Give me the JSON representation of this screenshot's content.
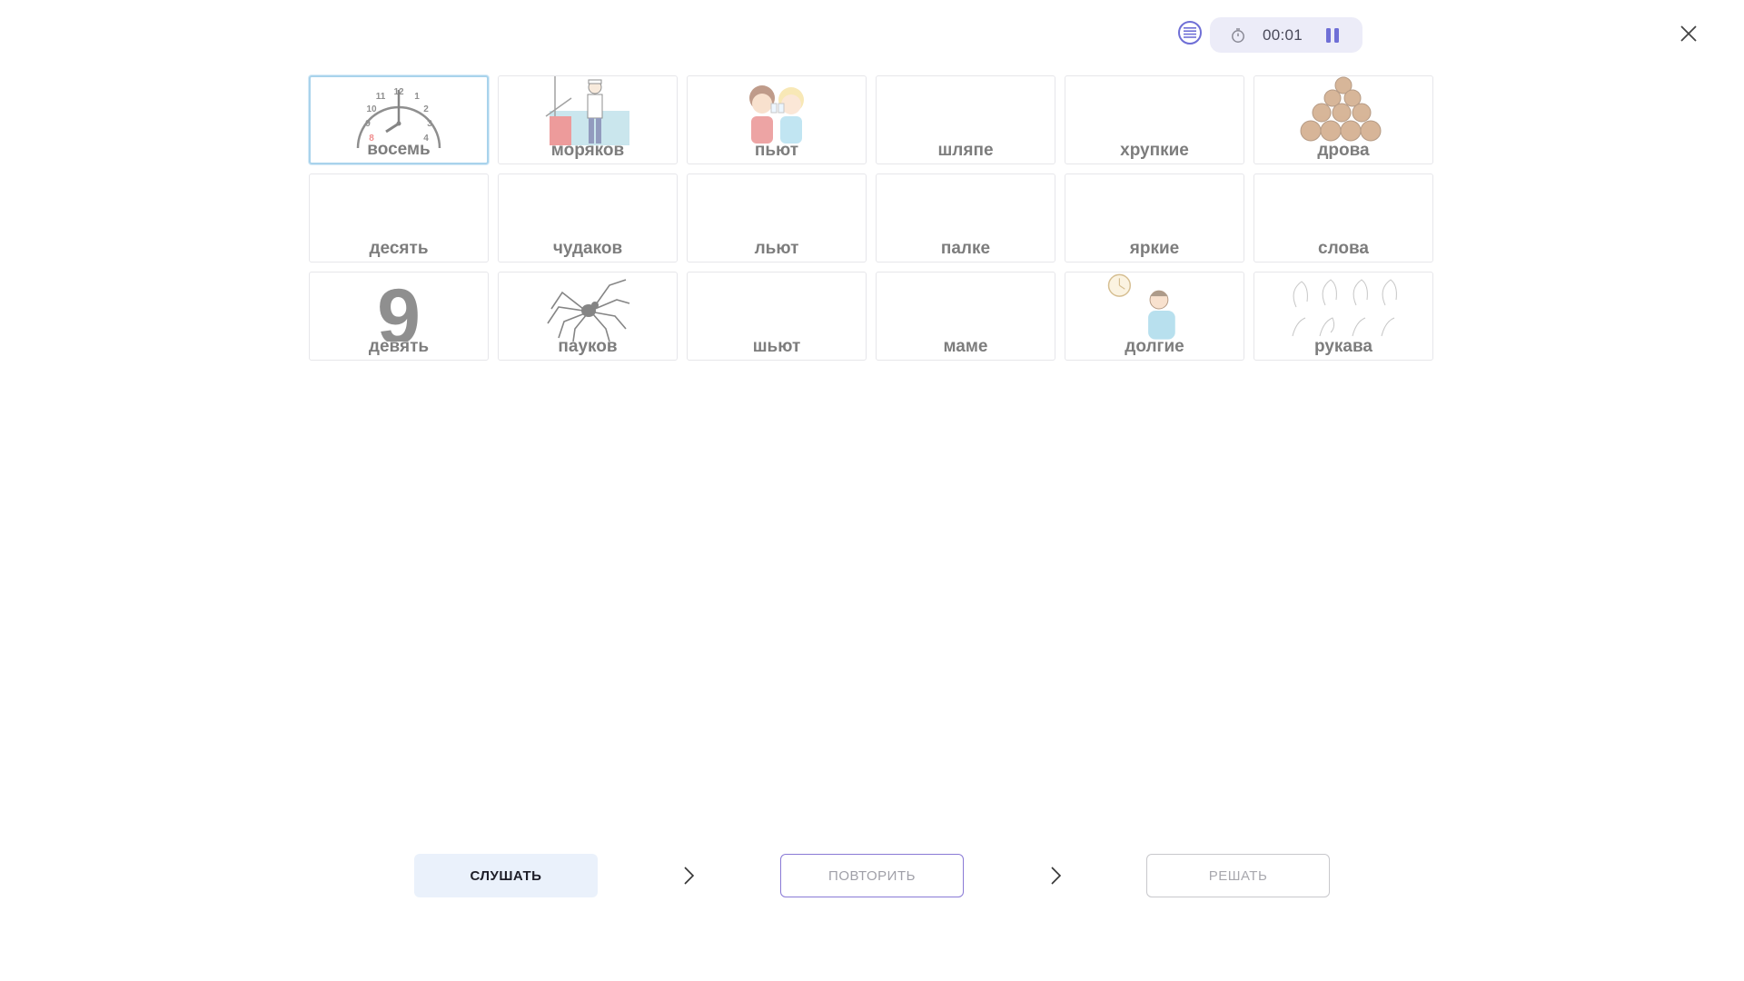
{
  "timer": {
    "value": "00:01"
  },
  "cards": [
    {
      "word": "восемь",
      "icon": "clock-icon",
      "selected": true
    },
    {
      "word": "моряков",
      "icon": "sailor-icon",
      "selected": false
    },
    {
      "word": "пьют",
      "icon": "children-drinking-icon",
      "selected": false
    },
    {
      "word": "шляпе",
      "icon": "none",
      "selected": false
    },
    {
      "word": "хрупкие",
      "icon": "none",
      "selected": false
    },
    {
      "word": "дрова",
      "icon": "firewood-icon",
      "selected": false
    },
    {
      "word": "десять",
      "icon": "none",
      "selected": false
    },
    {
      "word": "чудаков",
      "icon": "none",
      "selected": false
    },
    {
      "word": "льют",
      "icon": "none",
      "selected": false
    },
    {
      "word": "палке",
      "icon": "none",
      "selected": false
    },
    {
      "word": "яркие",
      "icon": "none",
      "selected": false
    },
    {
      "word": "слова",
      "icon": "none",
      "selected": false
    },
    {
      "word": "девять",
      "icon": "digit-nine-icon",
      "selected": false,
      "picture_text": "9"
    },
    {
      "word": "пауков",
      "icon": "spider-icon",
      "selected": false
    },
    {
      "word": "шьют",
      "icon": "none",
      "selected": false
    },
    {
      "word": "маме",
      "icon": "none",
      "selected": false
    },
    {
      "word": "долгие",
      "icon": "waiting-man-icon",
      "selected": false
    },
    {
      "word": "рукава",
      "icon": "sleeves-icon",
      "selected": false
    }
  ],
  "clock_numbers": [
    "12",
    "1",
    "2",
    "3",
    "4",
    "8",
    "9",
    "10",
    "11"
  ],
  "buttons": {
    "listen": "СЛУШАТЬ",
    "repeat": "ПОВТОРИТЬ",
    "solve": "РЕШАТЬ"
  },
  "colors": {
    "accent": "#6f6fd6",
    "selected_border": "#a9d3ec",
    "word_text": "#7d7d7d",
    "listen_bg": "#eaf1fb"
  }
}
